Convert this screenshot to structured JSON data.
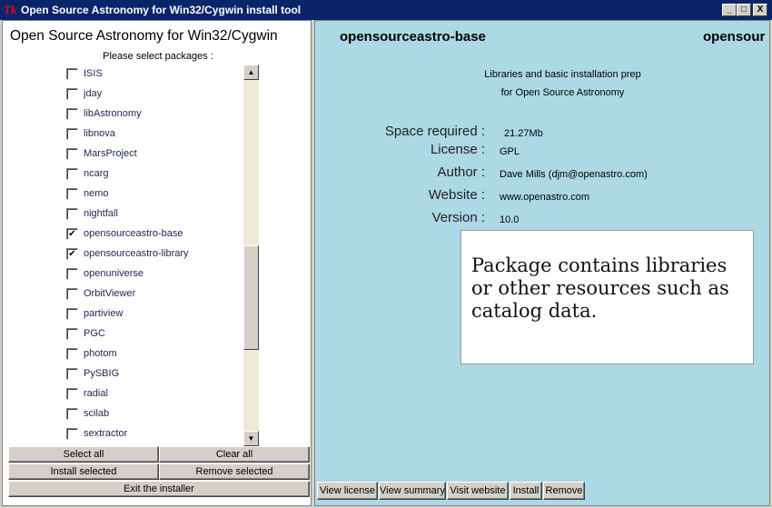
{
  "window": {
    "title": "Open Source Astronomy for Win32/Cygwin install tool",
    "icon": "Tk",
    "controls": {
      "minimize": "_",
      "maximize": "□",
      "close": "X"
    }
  },
  "left": {
    "title": "Open Source Astronomy for Win32/Cygwin",
    "subtitle": "Please select packages :",
    "packages": [
      {
        "label": "ISIS",
        "checked": false
      },
      {
        "label": "jday",
        "checked": false
      },
      {
        "label": "libAstronomy",
        "checked": false
      },
      {
        "label": "libnova",
        "checked": false
      },
      {
        "label": "MarsProject",
        "checked": false
      },
      {
        "label": "ncarg",
        "checked": false
      },
      {
        "label": "nemo",
        "checked": false
      },
      {
        "label": "nightfall",
        "checked": false
      },
      {
        "label": "opensourceastro-base",
        "checked": true
      },
      {
        "label": "opensourceastro-library",
        "checked": true
      },
      {
        "label": "openuniverse",
        "checked": false
      },
      {
        "label": "OrbitViewer",
        "checked": false
      },
      {
        "label": "partiview",
        "checked": false
      },
      {
        "label": "PGC",
        "checked": false
      },
      {
        "label": "photom",
        "checked": false
      },
      {
        "label": "PySBIG",
        "checked": false
      },
      {
        "label": "radial",
        "checked": false
      },
      {
        "label": "scilab",
        "checked": false
      },
      {
        "label": "sextractor",
        "checked": false
      }
    ],
    "scroll": {
      "up_glyph": "▲",
      "down_glyph": "▼"
    },
    "buttons": {
      "select_all": "Select all",
      "clear_all": "Clear all",
      "install_selected": "Install selected",
      "remove_selected": "Remove selected",
      "exit": "Exit the installer"
    }
  },
  "right": {
    "package_name": "opensourceastro-base",
    "package_name_cut": "opensour",
    "description": [
      "Libraries and basic installation prep",
      "for Open Source Astronomy"
    ],
    "fields": [
      {
        "label": "Space required :",
        "value": "21.27Mb"
      },
      {
        "label": "License :",
        "value": "GPL"
      },
      {
        "label": "Author :",
        "value": "Dave Mills (djm@openastro.com)"
      },
      {
        "label": "Website :",
        "value": "www.openastro.com"
      },
      {
        "label": "Version :",
        "value": "10.0"
      }
    ],
    "note": "Package contains libraries or other resources such as catalog data.",
    "buttons": {
      "view_license": "View license",
      "view_summary": "View summary",
      "visit_website": "Visit website",
      "install": "Install",
      "remove": "Remove"
    }
  }
}
